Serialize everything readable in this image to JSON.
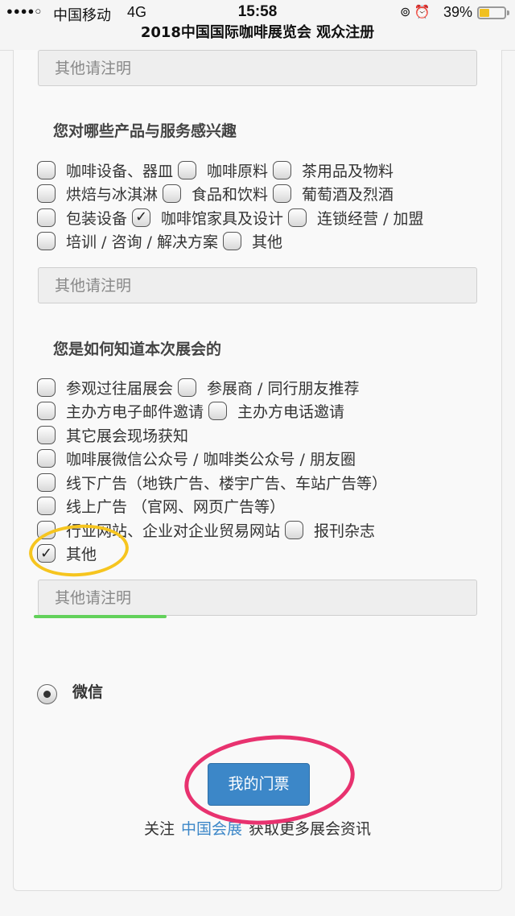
{
  "status_bar": {
    "signal": "●●●●○",
    "carrier": "中国移动",
    "network": "4G",
    "time": "15:58",
    "icons": "⊚ ⏰",
    "battery": "39%"
  },
  "page_title": "2018中国国际咖啡展览会 观众注册",
  "top_field": {
    "placeholder": "其他请注明"
  },
  "products": {
    "title": "您对哪些产品与服务感兴趣",
    "rows": [
      [
        {
          "label": "咖啡设备、器皿",
          "mark": ""
        },
        {
          "label": "咖啡原料",
          "mark": ""
        },
        {
          "label": "茶用品及物料",
          "mark": ""
        }
      ],
      [
        {
          "label": "烘焙与冰淇淋",
          "mark": ""
        },
        {
          "label": "食品和饮料",
          "mark": ""
        },
        {
          "label": "葡萄酒及烈酒",
          "mark": ""
        }
      ],
      [
        {
          "label": "包装设备",
          "mark": ""
        },
        {
          "label": "咖啡馆家具及设计",
          "mark": "✓"
        },
        {
          "label": "连锁经营 / 加盟",
          "mark": ""
        }
      ],
      [
        {
          "label": "培训 / 咨询 / 解决方案",
          "mark": ""
        },
        {
          "label": "其他",
          "mark": ""
        }
      ]
    ],
    "other_placeholder": "其他请注明"
  },
  "source": {
    "title": "您是如何知道本次展会的",
    "rows": [
      [
        {
          "label": "参观过往届展会",
          "mark": ""
        },
        {
          "label": "参展商 / 同行朋友推荐",
          "mark": ""
        }
      ],
      [
        {
          "label": "主办方电子邮件邀请",
          "mark": ""
        },
        {
          "label": "主办方电话邀请",
          "mark": ""
        }
      ],
      [
        {
          "label": "其它展会现场获知",
          "mark": ""
        }
      ],
      [
        {
          "label": "咖啡展微信公众号 / 咖啡类公众号 / 朋友圈",
          "mark": ""
        }
      ],
      [
        {
          "label": "线下广告（地铁广告、楼宇广告、车站广告等）",
          "mark": ""
        }
      ],
      [
        {
          "label": "线上广告 （官网、网页广告等）",
          "mark": ""
        }
      ],
      [
        {
          "label": "行业网站、企业对企业贸易网站",
          "mark": ""
        },
        {
          "label": "报刊杂志",
          "mark": ""
        }
      ],
      [
        {
          "label": "其他",
          "mark": "✓"
        }
      ]
    ],
    "other_placeholder": "其他请注明"
  },
  "payment": {
    "option": "微信",
    "selected": true
  },
  "ticket_button": "我的门票",
  "follow": {
    "prefix": "关注",
    "link": "中国会展",
    "suffix": "获取更多展会资讯"
  },
  "annotation_colors": {
    "circle_other": "#f6c51f",
    "underline_field": "#62d15a",
    "circle_button": "#e8326f"
  }
}
